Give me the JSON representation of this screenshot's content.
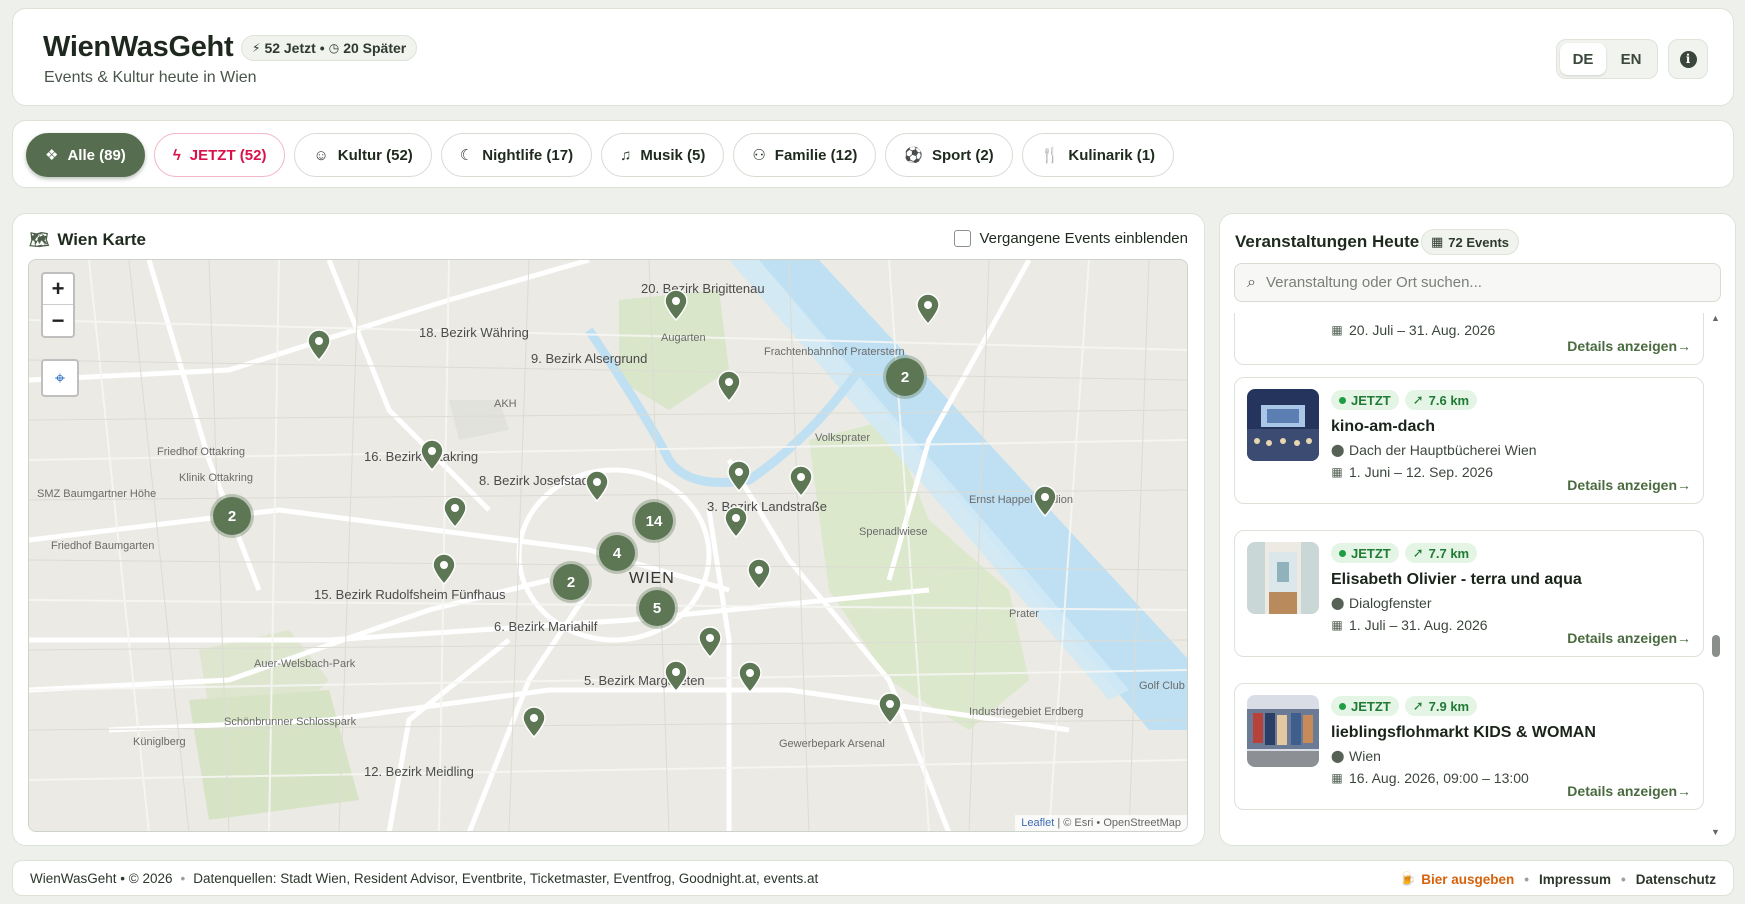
{
  "header": {
    "title": "WienWasGeht",
    "status_now": "52 Jetzt",
    "status_sep": "•",
    "status_later": "20 Später",
    "subtitle": "Events & Kultur heute in Wien",
    "lang_de": "DE",
    "lang_en": "EN",
    "active_lang": "DE"
  },
  "filters": [
    {
      "label": "Alle (89)",
      "icon": "layers-icon",
      "active": true
    },
    {
      "label": "JETZT (52)",
      "icon": "bolt-icon",
      "active": false
    },
    {
      "label": "Kultur (52)",
      "icon": "theater-masks-icon",
      "active": false
    },
    {
      "label": "Nightlife (17)",
      "icon": "moon-icon",
      "active": false
    },
    {
      "label": "Musik (5)",
      "icon": "music-note-icon",
      "active": false
    },
    {
      "label": "Familie (12)",
      "icon": "family-icon",
      "active": false
    },
    {
      "label": "Sport (2)",
      "icon": "soccer-ball-icon",
      "active": false
    },
    {
      "label": "Kulinarik (1)",
      "icon": "cutlery-icon",
      "active": false
    }
  ],
  "map": {
    "title": "Wien Karte",
    "past_events_label": "Vergangene Events einblenden",
    "past_events_checked": false,
    "zoom_in": "+",
    "zoom_out": "−",
    "attribution_leaflet": "Leaflet",
    "attribution_rest": "| © Esri • OpenStreetMap",
    "city_label": "WIEN",
    "district_labels": [
      "20. Bezirk Brigittenau",
      "18. Bezirk Währing",
      "9. Bezirk Alsergrund",
      "16. Bezirk Ottakring",
      "8. Bezirk Josefstadt",
      "3. Bezirk Landstraße",
      "15. Bezirk Rudolfsheim Fünfhaus",
      "6. Bezirk Mariahilf",
      "5. Bezirk Margareten",
      "12. Bezirk Meidling"
    ],
    "place_labels": [
      "Augarten",
      "Frachtenbahnhof Praterstern",
      "AKH",
      "Volksprater",
      "Ernst Happel Stadion",
      "Spenadlwiese",
      "Prater",
      "Friedhof Ottakring",
      "Klinik Ottakring",
      "SMZ Baumgartner Höhe",
      "Friedhof Baumgarten",
      "Auer-Welsbach-Park",
      "Schönbrunner Schlosspark",
      "Küniglberg",
      "Gewerbepark Arsenal",
      "Industriegebiet Erdberg",
      "Golf Club Wien"
    ],
    "clusters": [
      "2",
      "2",
      "14",
      "4",
      "2",
      "5"
    ],
    "accent": "#5d7755"
  },
  "events_panel": {
    "title": "Veranstaltungen Heute",
    "count_label": "72 Events",
    "search_placeholder": "Veranstaltung oder Ort suchen...",
    "partial_event": {
      "date": "20. Juli – 31. Aug. 2026",
      "details": "Details anzeigen→"
    },
    "events": [
      {
        "status": "JETZT",
        "distance": "7.6 km",
        "name": "kino-am-dach",
        "location": "Dach der Hauptbücherei Wien",
        "date": "1. Juni – 12. Sep. 2026",
        "details": "Details anzeigen→"
      },
      {
        "status": "JETZT",
        "distance": "7.7 km",
        "name": "Elisabeth Olivier - terra und aqua",
        "location": "Dialogfenster",
        "date": "1. Juli – 31. Aug. 2026",
        "details": "Details anzeigen→"
      },
      {
        "status": "JETZT",
        "distance": "7.9 km",
        "name": "lieblingsflohmarkt KIDS & WOMAN",
        "location": "Wien",
        "date": "16. Aug. 2026, 09:00 – 13:00",
        "details": "Details anzeigen→"
      }
    ]
  },
  "footer": {
    "brand": "WienWasGeht • © 2026",
    "sources": "Datenquellen: Stadt Wien, Resident Advisor, Eventbrite, Ticketmaster, Eventfrog, Goodnight.at, events.at",
    "beer": "Bier ausgeben",
    "imprint": "Impressum",
    "privacy": "Datenschutz"
  }
}
